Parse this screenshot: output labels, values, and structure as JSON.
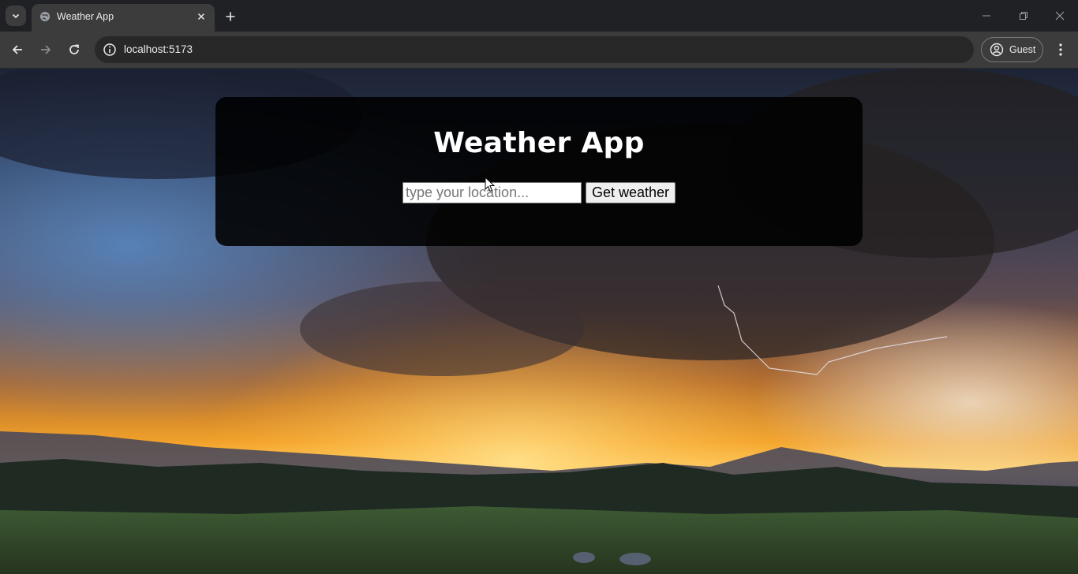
{
  "browser": {
    "tab": {
      "title": "Weather App",
      "favicon": "globe-icon"
    },
    "url": "localhost:5173",
    "profile_label": "Guest",
    "icons": {
      "tab_search": "chevron-down-icon",
      "close_tab": "close-icon",
      "new_tab": "plus-icon",
      "back": "arrow-left-icon",
      "forward": "arrow-right-icon",
      "reload": "reload-icon",
      "site_info": "info-icon",
      "profile": "person-icon",
      "menu": "kebab-menu-icon",
      "minimize": "minimize-icon",
      "restore": "restore-icon",
      "close_window": "close-icon"
    }
  },
  "app": {
    "title": "Weather App",
    "location_input": {
      "placeholder": "type your location...",
      "value": ""
    },
    "get_weather_label": "Get weather"
  },
  "colors": {
    "chrome_dark": "#202124",
    "chrome_toolbar": "#3c3c3c",
    "card_bg": "#000000",
    "title_text": "#ffffff"
  }
}
